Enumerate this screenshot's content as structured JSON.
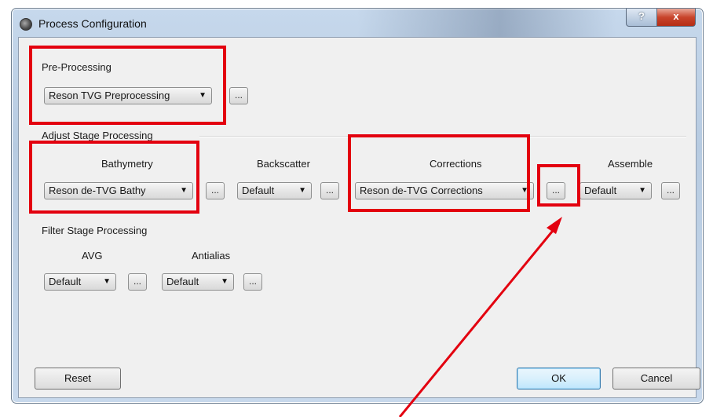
{
  "window": {
    "title": "Process Configuration",
    "help_label": "?",
    "close_label": "x"
  },
  "pre_processing": {
    "heading": "Pre-Processing",
    "selected": "Reson TVG Preprocessing",
    "dots_label": "..."
  },
  "adjust_stage": {
    "heading": "Adjust Stage Processing",
    "bathymetry": {
      "label": "Bathymetry",
      "selected": "Reson de-TVG Bathy",
      "dots_label": "..."
    },
    "backscatter": {
      "label": "Backscatter",
      "selected": "Default",
      "dots_label": "..."
    },
    "corrections": {
      "label": "Corrections",
      "selected": "Reson de-TVG Corrections",
      "dots_label": "..."
    },
    "assemble": {
      "label": "Assemble",
      "selected": "Default",
      "dots_label": "..."
    }
  },
  "filter_stage": {
    "heading": "Filter Stage Processing",
    "avg": {
      "label": "AVG",
      "selected": "Default",
      "dots_label": "..."
    },
    "antialias": {
      "label": "Antialias",
      "selected": "Default",
      "dots_label": "..."
    }
  },
  "buttons": {
    "reset": "Reset",
    "ok": "OK",
    "cancel": "Cancel"
  },
  "icons": {
    "dropdown": "dropdown-arrow-icon",
    "app": "app-icon"
  },
  "colors": {
    "annotation_red": "#e3000f",
    "title_bar": "#b7cbe1",
    "default_button": "#bee6fd"
  }
}
